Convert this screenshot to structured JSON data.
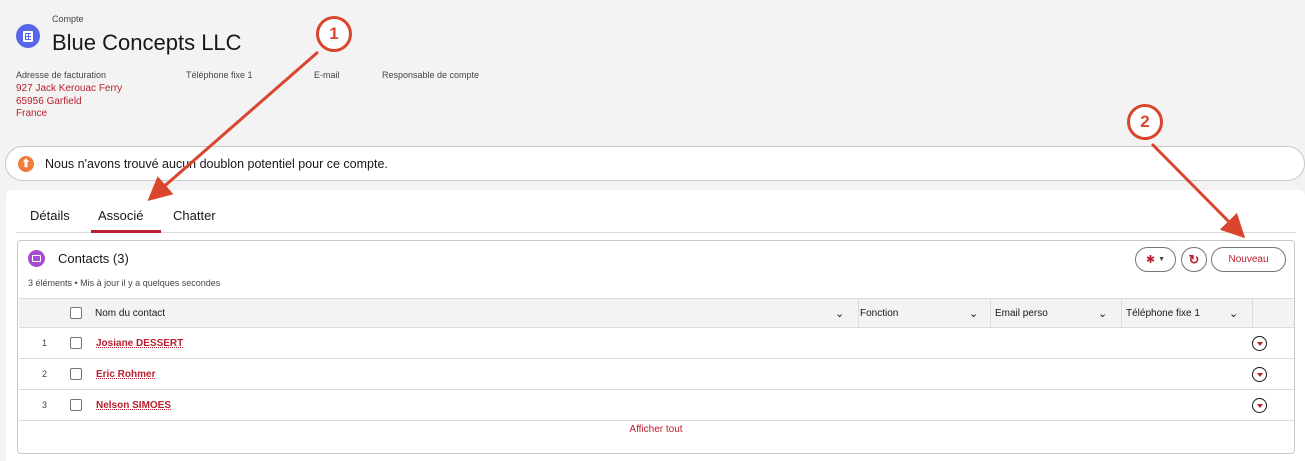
{
  "header": {
    "object_label": "Compte",
    "account_name": "Blue Concepts LLC",
    "fields": {
      "billing_label": "Adresse de facturation",
      "phone_label": "Téléphone fixe 1",
      "email_label": "E-mail",
      "owner_label": "Responsable de compte"
    },
    "address": {
      "line1": "927 Jack Kerouac Ferry",
      "line2": "65956 Garfield",
      "line3": "France"
    }
  },
  "duplicate_banner": {
    "text": "Nous n'avons trouvé aucun doublon potentiel pour ce compte."
  },
  "tabs": [
    {
      "label": "Détails"
    },
    {
      "label": "Associé"
    },
    {
      "label": "Chatter"
    }
  ],
  "related_list": {
    "title": "Contacts (3)",
    "subtitle": "3 éléments • Mis à jour il y a quelques secondes",
    "new_button": "Nouveau",
    "columns": [
      "Nom du contact",
      "Fonction",
      "Email perso",
      "Téléphone fixe 1"
    ],
    "rows": [
      {
        "num": "1",
        "name": "Josiane DESSERT"
      },
      {
        "num": "2",
        "name": "Eric Rohmer"
      },
      {
        "num": "3",
        "name": "Nelson SIMOES"
      }
    ],
    "show_all": "Afficher tout"
  },
  "annotations": {
    "callout1": "1",
    "callout2": "2"
  },
  "colors": {
    "accent": "#b8202f",
    "annotation": "#d9452d",
    "account_icon": "#5867e8",
    "contact_icon": "#a94ad4",
    "warning_icon": "#f27b3c"
  }
}
